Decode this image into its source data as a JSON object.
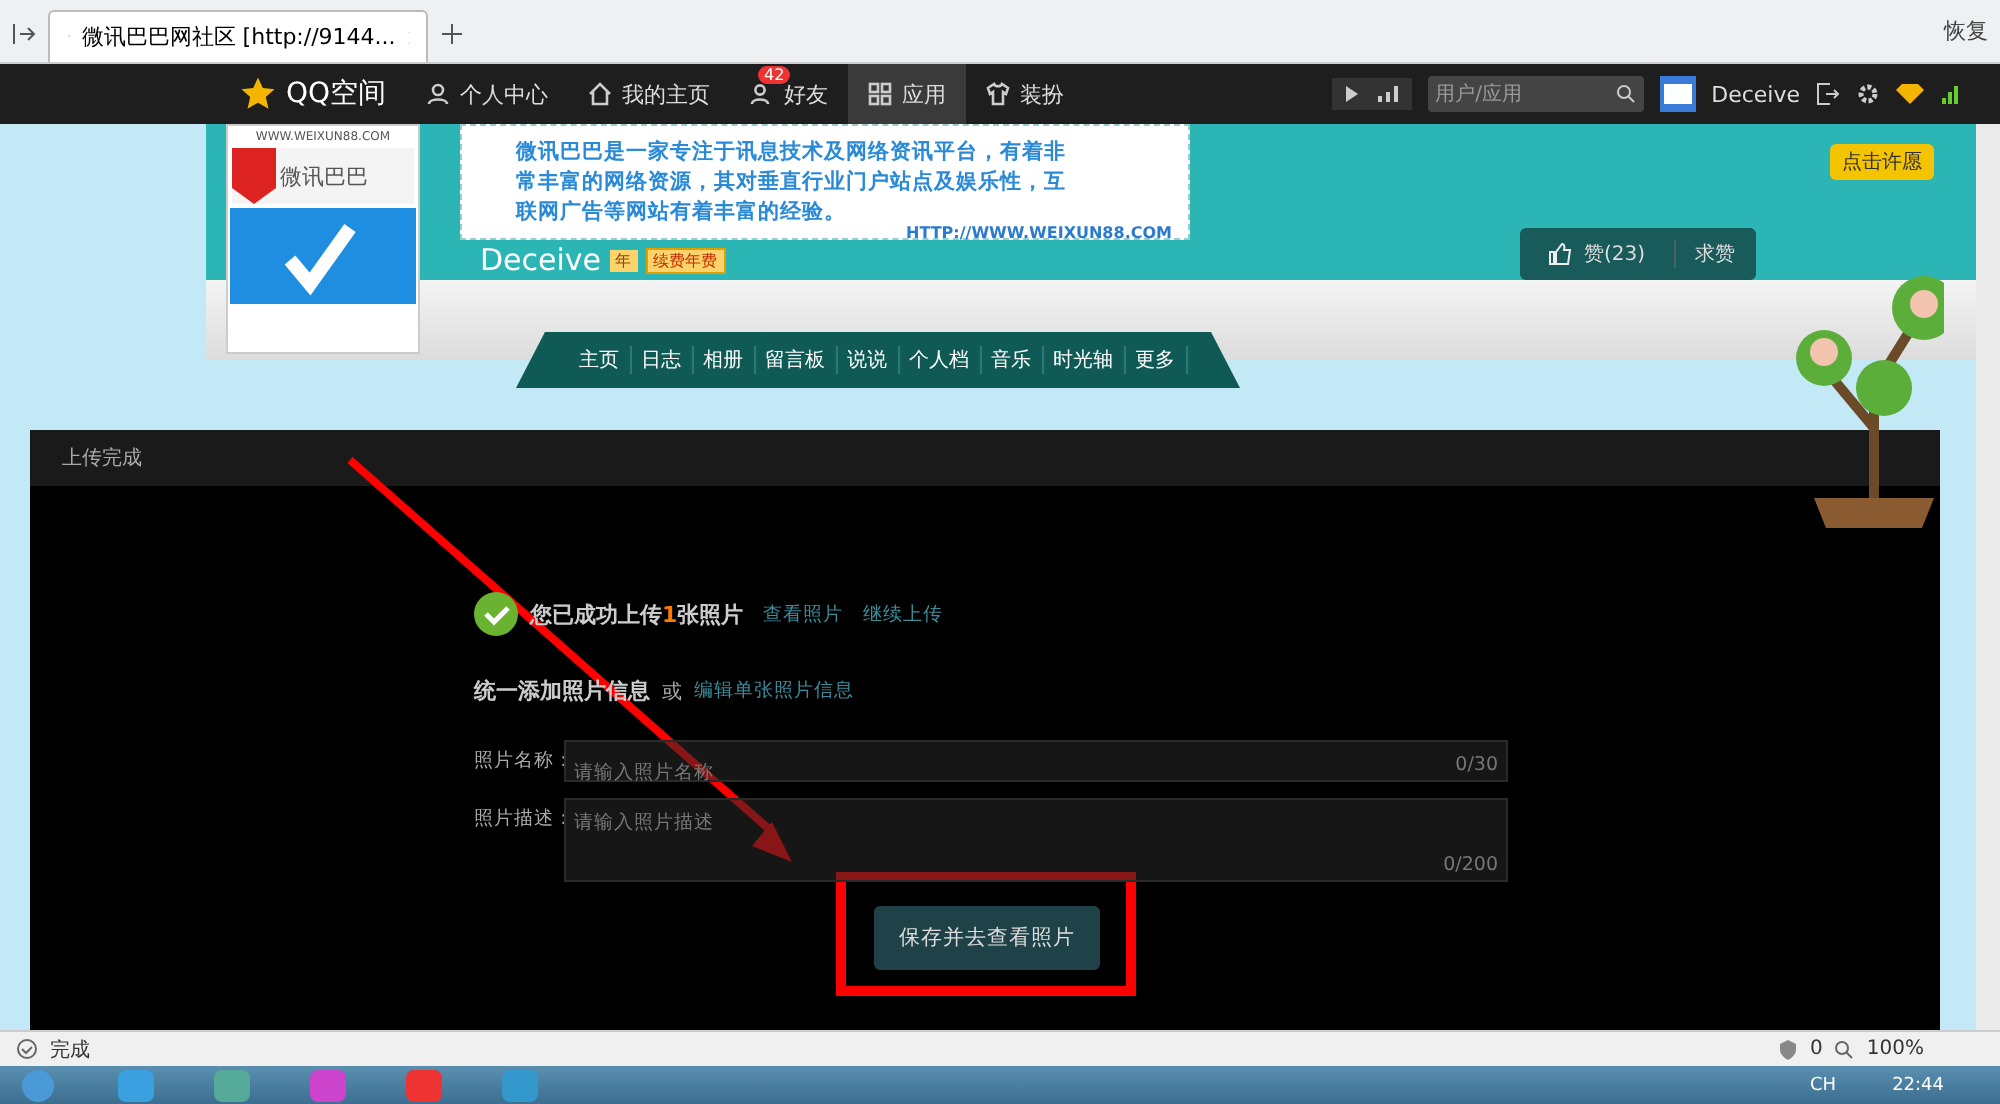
{
  "browser": {
    "tab_title": "微讯巴巴网社区 [http://9144...",
    "restore": "恢复"
  },
  "qq_nav": {
    "logo": "QQ空间",
    "items": [
      {
        "label": "个人中心",
        "selected": false
      },
      {
        "label": "我的主页",
        "selected": false
      },
      {
        "label": "好友",
        "selected": false,
        "badge": "42"
      },
      {
        "label": "应用",
        "selected": true
      },
      {
        "label": "装扮",
        "selected": false
      }
    ],
    "search": {
      "placeholder": "用户/应用"
    },
    "user": "Deceive"
  },
  "banner": {
    "intro": "微讯巴巴是一家专注于讯息技术及网络资讯平台，有着非常丰富的网络资源，其对垂直行业门户站点及娱乐性，互联网广告等网站有着丰富的经验。",
    "url": "HTTP://WWW.WEIXUN88.COM",
    "logo_text": "微讯巴巴",
    "logo_url": "WWW.WEIXUN88.COM",
    "owner": "Deceive",
    "vip_years": "年",
    "renew": "续费年费",
    "like": "赞(23)",
    "ask": "求赞",
    "corner": "点击许愿",
    "nav": [
      "主页",
      "日志",
      "相册",
      "留言板",
      "说说",
      "个人档",
      "音乐",
      "时光轴",
      "更多"
    ]
  },
  "dialog": {
    "title": "上传完成",
    "success": {
      "before": "您已成功上传",
      "count": "1",
      "after": "张照片"
    },
    "links": [
      "查看照片",
      "继续上传"
    ],
    "section": "统一添加照片信息",
    "or": "或",
    "edit_link": "编辑单张照片信息",
    "fields": [
      {
        "label": "照片名称：",
        "placeholder": "请输入照片名称",
        "counter": "0/30",
        "kind": "line"
      },
      {
        "label": "照片描述：",
        "placeholder": "请输入照片描述",
        "counter": "0/200",
        "kind": "area"
      }
    ],
    "save": "保存并去查看照片"
  },
  "status_bar": {
    "text": "完成",
    "blocked": "0",
    "zoom": "100%"
  },
  "taskbar": {
    "lang": "CH",
    "time": "22:44"
  }
}
